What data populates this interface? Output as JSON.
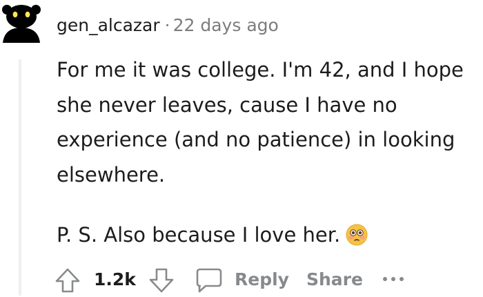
{
  "comment": {
    "username": "gen_alcazar",
    "separator": "·",
    "timestamp": "22 days ago",
    "paragraphs": [
      "For me it was college. I'm 42, and I hope she never leaves, cause I have no experience (and no patience) in looking elsewhere.",
      "P. S. Also because I love her."
    ]
  },
  "actions": {
    "vote_count": "1.2k",
    "reply_label": "Reply",
    "share_label": "Share"
  },
  "icons": {
    "avatar": "snoo-avatar-icon",
    "upvote": "arrow-up-icon",
    "downvote": "arrow-down-icon",
    "reply": "speech-bubble-icon",
    "more": "ellipsis-icon",
    "emoji": "flushed-face-emoji-icon"
  },
  "colors": {
    "text": "#1c1c1c",
    "meta": "#7c7c7c",
    "action": "#878a8c",
    "thread_line": "#edeff1"
  }
}
